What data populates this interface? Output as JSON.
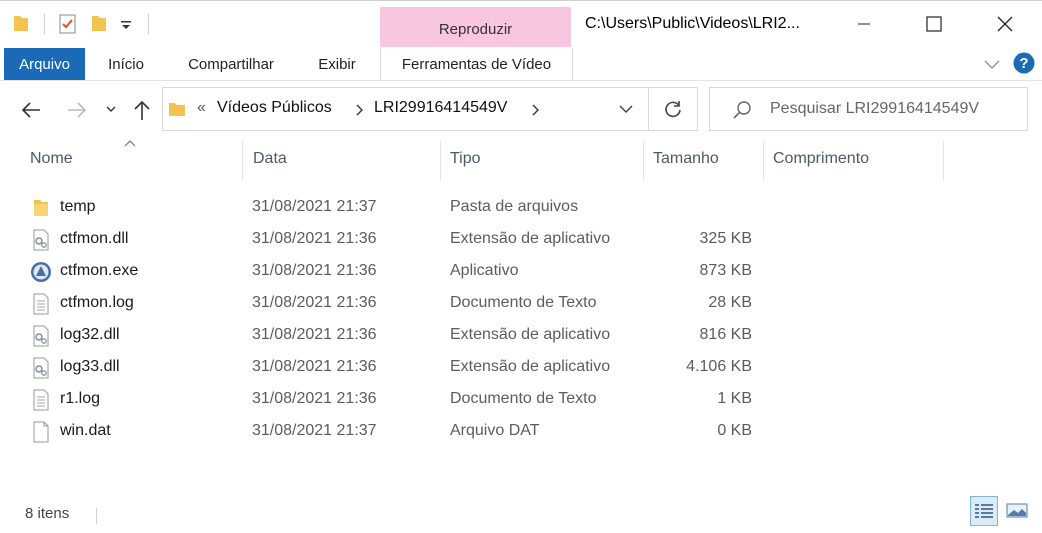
{
  "window": {
    "title": "C:\\Users\\Public\\Videos\\LRI2...",
    "context_tab": "Reproduzir"
  },
  "ribbon": {
    "tabs": [
      "Arquivo",
      "Início",
      "Compartilhar",
      "Exibir",
      "Ferramentas de Vídeo"
    ]
  },
  "address": {
    "overflow": "«",
    "crumbs": [
      "Vídeos Públicos",
      "LRI29916414549V"
    ]
  },
  "search": {
    "placeholder": "Pesquisar LRI29916414549V"
  },
  "columns": [
    "Nome",
    "Data",
    "Tipo",
    "Tamanho",
    "Comprimento"
  ],
  "files": [
    {
      "name": "temp",
      "date": "31/08/2021 21:37",
      "type": "Pasta de arquivos",
      "size": "",
      "icon": "folder-icon"
    },
    {
      "name": "ctfmon.dll",
      "date": "31/08/2021 21:36",
      "type": "Extensão de aplicativo",
      "size": "325 KB",
      "icon": "dll-file-icon"
    },
    {
      "name": "ctfmon.exe",
      "date": "31/08/2021 21:36",
      "type": "Aplicativo",
      "size": "873 KB",
      "icon": "exe-app-icon"
    },
    {
      "name": "ctfmon.log",
      "date": "31/08/2021 21:36",
      "type": "Documento de Texto",
      "size": "28 KB",
      "icon": "text-file-icon"
    },
    {
      "name": "log32.dll",
      "date": "31/08/2021 21:36",
      "type": "Extensão de aplicativo",
      "size": "816 KB",
      "icon": "dll-file-icon"
    },
    {
      "name": "log33.dll",
      "date": "31/08/2021 21:36",
      "type": "Extensão de aplicativo",
      "size": "4.106 KB",
      "icon": "dll-file-icon"
    },
    {
      "name": "r1.log",
      "date": "31/08/2021 21:36",
      "type": "Documento de Texto",
      "size": "1 KB",
      "icon": "text-file-icon"
    },
    {
      "name": "win.dat",
      "date": "31/08/2021 21:37",
      "type": "Arquivo DAT",
      "size": "0 KB",
      "icon": "blank-file-icon"
    }
  ],
  "status": {
    "count": "8 itens"
  },
  "colors": {
    "file_tab": "#1a6ab8",
    "context_tab": "#f8c6e0",
    "help": "#1a6ab8"
  }
}
